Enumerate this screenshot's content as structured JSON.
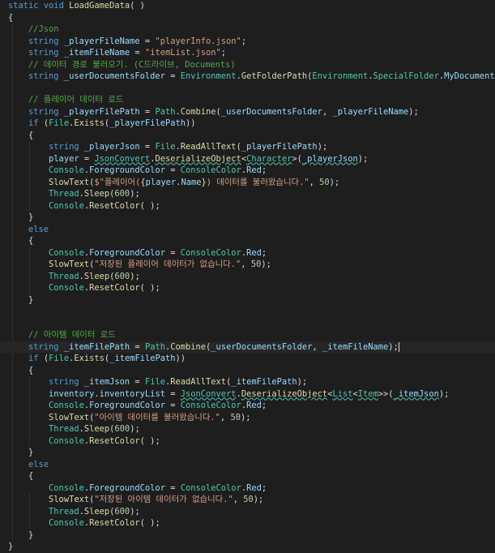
{
  "editor": {
    "caret_line": 29,
    "lines": [
      [
        [
          "key",
          "static "
        ],
        [
          "key",
          "void "
        ],
        [
          "fn",
          "LoadGameData"
        ],
        [
          "pl",
          "( )"
        ]
      ],
      [
        [
          "pl",
          "{"
        ]
      ],
      [
        [
          "pl",
          "    "
        ],
        [
          "cmt",
          "//Json"
        ]
      ],
      [
        [
          "pl",
          "    "
        ],
        [
          "key",
          "string "
        ],
        [
          "var",
          "_playerFileName"
        ],
        [
          "pl",
          " = "
        ],
        [
          "str",
          "\"playerInfo.json\""
        ],
        [
          "pl",
          ";"
        ]
      ],
      [
        [
          "pl",
          "    "
        ],
        [
          "key",
          "string "
        ],
        [
          "var",
          "_itemFileName"
        ],
        [
          "pl",
          " = "
        ],
        [
          "str",
          "\"itemList.json\""
        ],
        [
          "pl",
          ";"
        ]
      ],
      [
        [
          "pl",
          "    "
        ],
        [
          "cmt",
          "// 데이터 경로 불러오기. (C드라이브, Documents)"
        ]
      ],
      [
        [
          "pl",
          "    "
        ],
        [
          "key",
          "string "
        ],
        [
          "var",
          "_userDocumentsFolder"
        ],
        [
          "pl",
          " = "
        ],
        [
          "cls",
          "Environment"
        ],
        [
          "pl",
          "."
        ],
        [
          "fn",
          "GetFolderPath"
        ],
        [
          "pl",
          "("
        ],
        [
          "cls",
          "Environment"
        ],
        [
          "pl",
          "."
        ],
        [
          "cls",
          "SpecialFolder"
        ],
        [
          "pl",
          "."
        ],
        [
          "var",
          "MyDocuments"
        ],
        [
          "pl",
          ");"
        ]
      ],
      [],
      [
        [
          "pl",
          "    "
        ],
        [
          "cmt",
          "// 플레이어 데이터 로드"
        ]
      ],
      [
        [
          "pl",
          "    "
        ],
        [
          "key",
          "string "
        ],
        [
          "var",
          "_playerFilePath"
        ],
        [
          "pl",
          " = "
        ],
        [
          "cls",
          "Path"
        ],
        [
          "pl",
          "."
        ],
        [
          "fn",
          "Combine"
        ],
        [
          "pl",
          "("
        ],
        [
          "var",
          "_userDocumentsFolder"
        ],
        [
          "pl",
          ", "
        ],
        [
          "var",
          "_playerFileName"
        ],
        [
          "pl",
          ");"
        ]
      ],
      [
        [
          "pl",
          "    "
        ],
        [
          "key",
          "if "
        ],
        [
          "pl",
          "("
        ],
        [
          "cls",
          "File"
        ],
        [
          "pl",
          "."
        ],
        [
          "fn",
          "Exists"
        ],
        [
          "pl",
          "("
        ],
        [
          "var",
          "_playerFilePath"
        ],
        [
          "pl",
          "))"
        ]
      ],
      [
        [
          "pl",
          "    {"
        ]
      ],
      [
        [
          "pl",
          "        "
        ],
        [
          "key",
          "string "
        ],
        [
          "var",
          "_playerJson"
        ],
        [
          "pl",
          " = "
        ],
        [
          "cls",
          "File"
        ],
        [
          "pl",
          "."
        ],
        [
          "fn",
          "ReadAllText"
        ],
        [
          "pl",
          "("
        ],
        [
          "var",
          "_playerFilePath"
        ],
        [
          "pl",
          ");"
        ]
      ],
      [
        [
          "pl",
          "        "
        ],
        [
          "var",
          "player"
        ],
        [
          "pl",
          " = "
        ],
        [
          "cls sq",
          "JsonConvert"
        ],
        [
          "pl",
          "."
        ],
        [
          "fn sq",
          "DeserializeObject"
        ],
        [
          "pl",
          "<"
        ],
        [
          "cls sq",
          "Character"
        ],
        [
          "pl",
          ">("
        ],
        [
          "var sq",
          "_playerJson"
        ],
        [
          "pl",
          ");"
        ]
      ],
      [
        [
          "pl",
          "        "
        ],
        [
          "cls",
          "Console"
        ],
        [
          "pl",
          "."
        ],
        [
          "var",
          "ForegroundColor"
        ],
        [
          "pl",
          " = "
        ],
        [
          "cls",
          "ConsoleColor"
        ],
        [
          "pl",
          "."
        ],
        [
          "var",
          "Red"
        ],
        [
          "pl",
          ";"
        ]
      ],
      [
        [
          "pl",
          "        "
        ],
        [
          "fn",
          "SlowText"
        ],
        [
          "pl",
          "("
        ],
        [
          "str",
          "$\"플레이어("
        ],
        [
          "esc",
          "{"
        ],
        [
          "var",
          "player"
        ],
        [
          "pl",
          "."
        ],
        [
          "var",
          "Name"
        ],
        [
          "esc",
          "}"
        ],
        [
          "str",
          ") 데이터를 불러왔습니다.\""
        ],
        [
          "pl",
          ", "
        ],
        [
          "num",
          "50"
        ],
        [
          "pl",
          ");"
        ]
      ],
      [
        [
          "pl",
          "        "
        ],
        [
          "cls",
          "Thread"
        ],
        [
          "pl",
          "."
        ],
        [
          "fn",
          "Sleep"
        ],
        [
          "pl",
          "("
        ],
        [
          "num",
          "600"
        ],
        [
          "pl",
          ");"
        ]
      ],
      [
        [
          "pl",
          "        "
        ],
        [
          "cls",
          "Console"
        ],
        [
          "pl",
          "."
        ],
        [
          "fn",
          "ResetColor"
        ],
        [
          "pl",
          "( );"
        ]
      ],
      [
        [
          "pl",
          "    }"
        ]
      ],
      [
        [
          "pl",
          "    "
        ],
        [
          "key",
          "else"
        ]
      ],
      [
        [
          "pl",
          "    {"
        ]
      ],
      [
        [
          "pl",
          "        "
        ],
        [
          "cls",
          "Console"
        ],
        [
          "pl",
          "."
        ],
        [
          "var",
          "ForegroundColor"
        ],
        [
          "pl",
          " = "
        ],
        [
          "cls",
          "ConsoleColor"
        ],
        [
          "pl",
          "."
        ],
        [
          "var",
          "Red"
        ],
        [
          "pl",
          ";"
        ]
      ],
      [
        [
          "pl",
          "        "
        ],
        [
          "fn",
          "SlowText"
        ],
        [
          "pl",
          "("
        ],
        [
          "str",
          "\"저장된 플레이어 데이터가 없습니다.\""
        ],
        [
          "pl",
          ", "
        ],
        [
          "num",
          "50"
        ],
        [
          "pl",
          ");"
        ]
      ],
      [
        [
          "pl",
          "        "
        ],
        [
          "cls",
          "Thread"
        ],
        [
          "pl",
          "."
        ],
        [
          "fn",
          "Sleep"
        ],
        [
          "pl",
          "("
        ],
        [
          "num",
          "600"
        ],
        [
          "pl",
          ");"
        ]
      ],
      [
        [
          "pl",
          "        "
        ],
        [
          "cls",
          "Console"
        ],
        [
          "pl",
          "."
        ],
        [
          "fn",
          "ResetColor"
        ],
        [
          "pl",
          "( );"
        ]
      ],
      [
        [
          "pl",
          "    }"
        ]
      ],
      [],
      [],
      [
        [
          "pl",
          "    "
        ],
        [
          "cmt",
          "// 아이템 데이터 로드"
        ]
      ],
      [
        [
          "pl",
          "    "
        ],
        [
          "key",
          "string "
        ],
        [
          "var",
          "_itemFilePath"
        ],
        [
          "pl",
          " = "
        ],
        [
          "cls",
          "Path"
        ],
        [
          "pl",
          "."
        ],
        [
          "fn",
          "Combine"
        ],
        [
          "pl",
          "("
        ],
        [
          "var",
          "_userDocumentsFolder"
        ],
        [
          "pl",
          ", "
        ],
        [
          "var",
          "_itemFileName"
        ],
        [
          "pl",
          ");"
        ]
      ],
      [
        [
          "pl",
          "    "
        ],
        [
          "key",
          "if "
        ],
        [
          "pl",
          "("
        ],
        [
          "cls",
          "File"
        ],
        [
          "pl",
          "."
        ],
        [
          "fn",
          "Exists"
        ],
        [
          "pl",
          "("
        ],
        [
          "var",
          "_itemFilePath"
        ],
        [
          "pl",
          "))"
        ]
      ],
      [
        [
          "pl",
          "    {"
        ]
      ],
      [
        [
          "pl",
          "        "
        ],
        [
          "key",
          "string "
        ],
        [
          "var",
          "_itemJson"
        ],
        [
          "pl",
          " = "
        ],
        [
          "cls",
          "File"
        ],
        [
          "pl",
          "."
        ],
        [
          "fn",
          "ReadAllText"
        ],
        [
          "pl",
          "("
        ],
        [
          "var",
          "_itemFilePath"
        ],
        [
          "pl",
          ");"
        ]
      ],
      [
        [
          "pl",
          "        "
        ],
        [
          "var",
          "inventory"
        ],
        [
          "pl",
          "."
        ],
        [
          "var",
          "inventoryList"
        ],
        [
          "pl",
          " = "
        ],
        [
          "cls sq",
          "JsonConvert"
        ],
        [
          "pl",
          "."
        ],
        [
          "fn sq",
          "DeserializeObject"
        ],
        [
          "pl",
          "<"
        ],
        [
          "cls sq",
          "List"
        ],
        [
          "pl",
          "<"
        ],
        [
          "cls sq",
          "Item"
        ],
        [
          "pl",
          ">>("
        ],
        [
          "var sq",
          "_itemJson"
        ],
        [
          "pl",
          ");"
        ]
      ],
      [
        [
          "pl",
          "        "
        ],
        [
          "cls",
          "Console"
        ],
        [
          "pl",
          "."
        ],
        [
          "var",
          "ForegroundColor"
        ],
        [
          "pl",
          " = "
        ],
        [
          "cls",
          "ConsoleColor"
        ],
        [
          "pl",
          "."
        ],
        [
          "var",
          "Red"
        ],
        [
          "pl",
          ";"
        ]
      ],
      [
        [
          "pl",
          "        "
        ],
        [
          "fn",
          "SlowText"
        ],
        [
          "pl",
          "("
        ],
        [
          "str",
          "\"아이템 데이터를 불러왔습니다.\""
        ],
        [
          "pl",
          ", "
        ],
        [
          "num",
          "50"
        ],
        [
          "pl",
          ");"
        ]
      ],
      [
        [
          "pl",
          "        "
        ],
        [
          "cls",
          "Thread"
        ],
        [
          "pl",
          "."
        ],
        [
          "fn",
          "Sleep"
        ],
        [
          "pl",
          "("
        ],
        [
          "num",
          "600"
        ],
        [
          "pl",
          ");"
        ]
      ],
      [
        [
          "pl",
          "        "
        ],
        [
          "cls",
          "Console"
        ],
        [
          "pl",
          "."
        ],
        [
          "fn",
          "ResetColor"
        ],
        [
          "pl",
          "( );"
        ]
      ],
      [
        [
          "pl",
          "    }"
        ]
      ],
      [
        [
          "pl",
          "    "
        ],
        [
          "key",
          "else"
        ]
      ],
      [
        [
          "pl",
          "    {"
        ]
      ],
      [
        [
          "pl",
          "        "
        ],
        [
          "cls",
          "Console"
        ],
        [
          "pl",
          "."
        ],
        [
          "var",
          "ForegroundColor"
        ],
        [
          "pl",
          " = "
        ],
        [
          "cls",
          "ConsoleColor"
        ],
        [
          "pl",
          "."
        ],
        [
          "var",
          "Red"
        ],
        [
          "pl",
          ";"
        ]
      ],
      [
        [
          "pl",
          "        "
        ],
        [
          "fn",
          "SlowText"
        ],
        [
          "pl",
          "("
        ],
        [
          "str",
          "\"저장된 아이템 데이터가 없습니다.\""
        ],
        [
          "pl",
          ", "
        ],
        [
          "num",
          "50"
        ],
        [
          "pl",
          ");"
        ]
      ],
      [
        [
          "pl",
          "        "
        ],
        [
          "cls",
          "Thread"
        ],
        [
          "pl",
          "."
        ],
        [
          "fn",
          "Sleep"
        ],
        [
          "pl",
          "("
        ],
        [
          "num",
          "600"
        ],
        [
          "pl",
          ");"
        ]
      ],
      [
        [
          "pl",
          "        "
        ],
        [
          "cls",
          "Console"
        ],
        [
          "pl",
          "."
        ],
        [
          "fn",
          "ResetColor"
        ],
        [
          "pl",
          "( );"
        ]
      ],
      [
        [
          "pl",
          "    }"
        ]
      ],
      [
        [
          "pl",
          "}"
        ]
      ]
    ]
  }
}
